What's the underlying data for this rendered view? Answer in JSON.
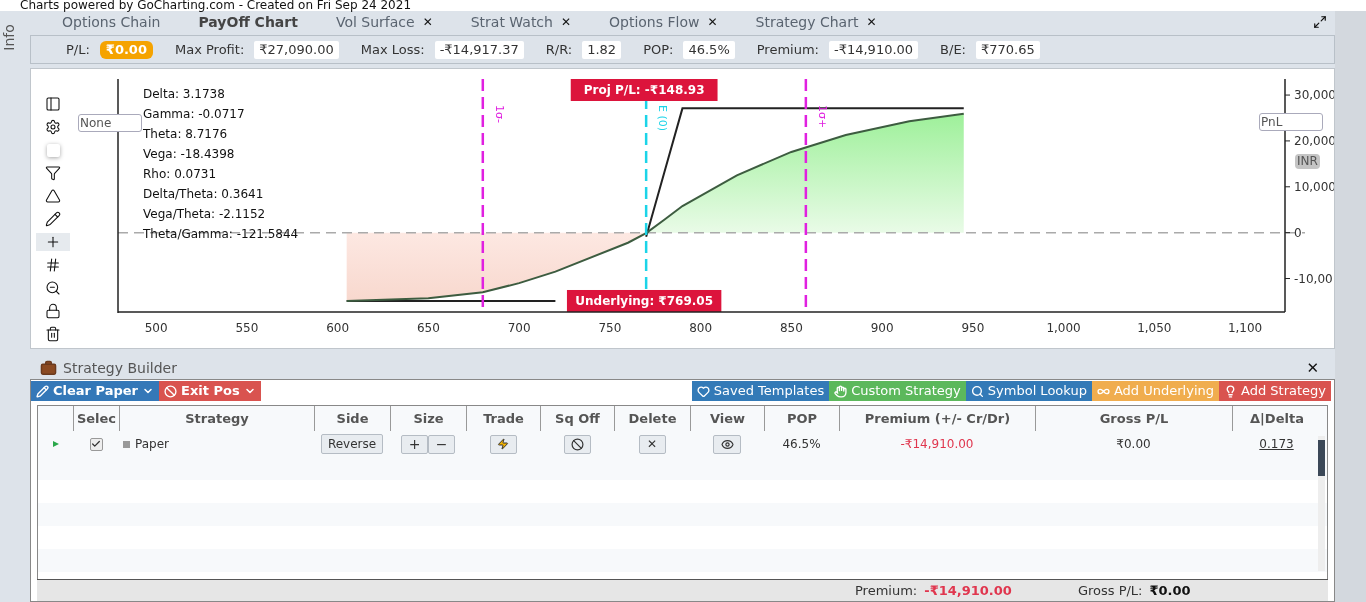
{
  "credit": "Charts powered by GoCharting.com - Created on Fri Sep 24 2021",
  "side_tab": "Info",
  "tabs": [
    {
      "label": "Options Chain",
      "selected": false,
      "closable": false
    },
    {
      "label": "PayOff Chart",
      "selected": true,
      "closable": false
    },
    {
      "label": "Vol Surface",
      "selected": false,
      "closable": true
    },
    {
      "label": "Strat Watch",
      "selected": false,
      "closable": true
    },
    {
      "label": "Options Flow",
      "selected": false,
      "closable": true
    },
    {
      "label": "Strategy Chart",
      "selected": false,
      "closable": true
    }
  ],
  "close_glyph": "✕",
  "stats": [
    {
      "label": "P/L:",
      "value": "₹0.00",
      "kind": "highlight"
    },
    {
      "label": "Max Profit:",
      "value": "₹27,090.00",
      "kind": "plain"
    },
    {
      "label": "Max Loss:",
      "value": "-₹14,917.37",
      "kind": "plain"
    },
    {
      "label": "R/R:",
      "value": "1.82",
      "kind": "plain"
    },
    {
      "label": "POP:",
      "value": "46.5%",
      "kind": "plain"
    },
    {
      "label": "Premium:",
      "value": "-₹14,910.00",
      "kind": "plain"
    },
    {
      "label": "B/E:",
      "value": "₹770.65",
      "kind": "plain"
    }
  ],
  "tools": [
    {
      "kind": "panel",
      "selected": false
    },
    {
      "kind": "settings",
      "selected": false
    },
    {
      "kind": "color",
      "selected": false
    },
    {
      "kind": "filter",
      "selected": false
    },
    {
      "kind": "triangle",
      "selected": false
    },
    {
      "kind": "pencil",
      "selected": false
    },
    {
      "kind": "crosshair",
      "selected": true
    },
    {
      "kind": "grid",
      "selected": false
    },
    {
      "kind": "zoom-out",
      "selected": false
    },
    {
      "kind": "lock",
      "selected": false
    },
    {
      "kind": "trash",
      "selected": false
    }
  ],
  "greeks": [
    "Delta: 3.1738",
    "Gamma: -0.0717",
    "Theta: 8.7176",
    "Vega: -18.4398",
    "Rho: 0.0731",
    "Delta/Theta: 0.3641",
    "Vega/Theta: -2.1152",
    "Theta/Gamma: -121.5844"
  ],
  "left_field": {
    "value": "None"
  },
  "right_field": {
    "value": "PnL"
  },
  "currency_badge": "INR",
  "chart_data": {
    "type": "line",
    "x": [
      605,
      650,
      680,
      700,
      720,
      760,
      770,
      780,
      790,
      820,
      850,
      880,
      915,
      945
    ],
    "series": [
      {
        "color": "#222222",
        "values": [
          -14900,
          -14900,
          -14900,
          -14900,
          -14900,
          null,
          -900,
          13100,
          27100,
          27100,
          27100,
          27100,
          27100,
          27100
        ]
      },
      {
        "color": "#3d5c40",
        "values": [
          -14900,
          -14300,
          -13000,
          -11000,
          -8500,
          -2200,
          -100,
          2800,
          5800,
          12500,
          17600,
          21300,
          24300,
          25900
        ]
      }
    ],
    "xlim": [
      479,
      1122
    ],
    "ylim": [
      -17300,
      33500
    ],
    "xticks": [
      500,
      550,
      600,
      650,
      700,
      750,
      800,
      850,
      900,
      950,
      {
        "value": 1000,
        "label": "1,000"
      },
      {
        "value": 1050,
        "label": "1,050"
      },
      {
        "value": 1100,
        "label": "1,100"
      }
    ],
    "yticks": [
      {
        "value": 30000,
        "label": "30,000"
      },
      {
        "value": 20000,
        "label": "20,000"
      },
      {
        "value": 10000,
        "label": "10,000"
      },
      0
    ],
    "ref_lines": [
      {
        "axis": "x",
        "value": 680,
        "label": "1σ-",
        "color": "#e020e0"
      },
      {
        "axis": "x",
        "value": 858,
        "label": "1σ+",
        "color": "#e020e0"
      },
      {
        "axis": "x",
        "value": 770,
        "label": "E (0)",
        "color": "#1bd4e8"
      }
    ],
    "annotations": [
      "Proj P/L: -₹148.93",
      "Underlying: ₹769.05"
    ]
  },
  "cut_tick_label": "-10,00",
  "builder": {
    "title": "Strategy Builder",
    "close": "✕",
    "left_actions": [
      {
        "label": "Clear Paper",
        "color": "#3478b8",
        "kind": "pencil"
      },
      {
        "label": "Exit Pos",
        "color": "#d9534f",
        "kind": "ban"
      }
    ],
    "actions": [
      {
        "label": "Saved Templates",
        "color": "#337ab7",
        "kind": "heart"
      },
      {
        "label": "Custom Strategy",
        "color": "#5cb85c",
        "kind": "hand"
      },
      {
        "label": "Symbol Lookup",
        "color": "#337ab7",
        "kind": "search"
      },
      {
        "label": "Add Underlying",
        "color": "#f0ad4e",
        "kind": "infinity"
      },
      {
        "label": "Add Strategy",
        "color": "#d9534f",
        "kind": "bulb"
      }
    ],
    "columns": [
      "Selec",
      "Strategy",
      "Side",
      "Size",
      "Trade",
      "Sq Off",
      "Delete",
      "View",
      "POP",
      "Premium (+/- Cr/Dr)",
      "Gross P/L",
      "Δ|Delta"
    ],
    "rows": [
      {
        "checked": true,
        "strategy": "Paper",
        "side": "Reverse",
        "plus": "+",
        "minus": "−",
        "delete": "✕",
        "pop": "46.5%",
        "premium": "-₹14,910.00",
        "negative": true,
        "gross_pl": "₹0.00",
        "delta": "0.173"
      }
    ],
    "footer": [
      {
        "label": "Premium:",
        "value": "-₹14,910.00",
        "negative": true
      },
      {
        "label": "Gross P/L:",
        "value": "₹0.00",
        "negative": false
      }
    ]
  }
}
